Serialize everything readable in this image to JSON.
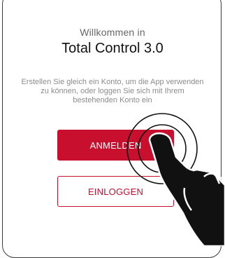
{
  "welcome": {
    "subtitle": "Willkommen in",
    "title": "Total Control 3.0",
    "description": "Erstellen Sie gleich ein Konto, um die App verwenden zu können, oder loggen Sie sich mit Ihrem bestehenden Konto ein"
  },
  "actions": {
    "register_label": "ANMELDEN",
    "login_label": "EINLOGGEN"
  },
  "colors": {
    "brand": "#c8102e",
    "title_text": "#111111",
    "muted_text": "#8c8c8c"
  },
  "overlay": {
    "icon": "tap-gesture-hand-icon"
  }
}
